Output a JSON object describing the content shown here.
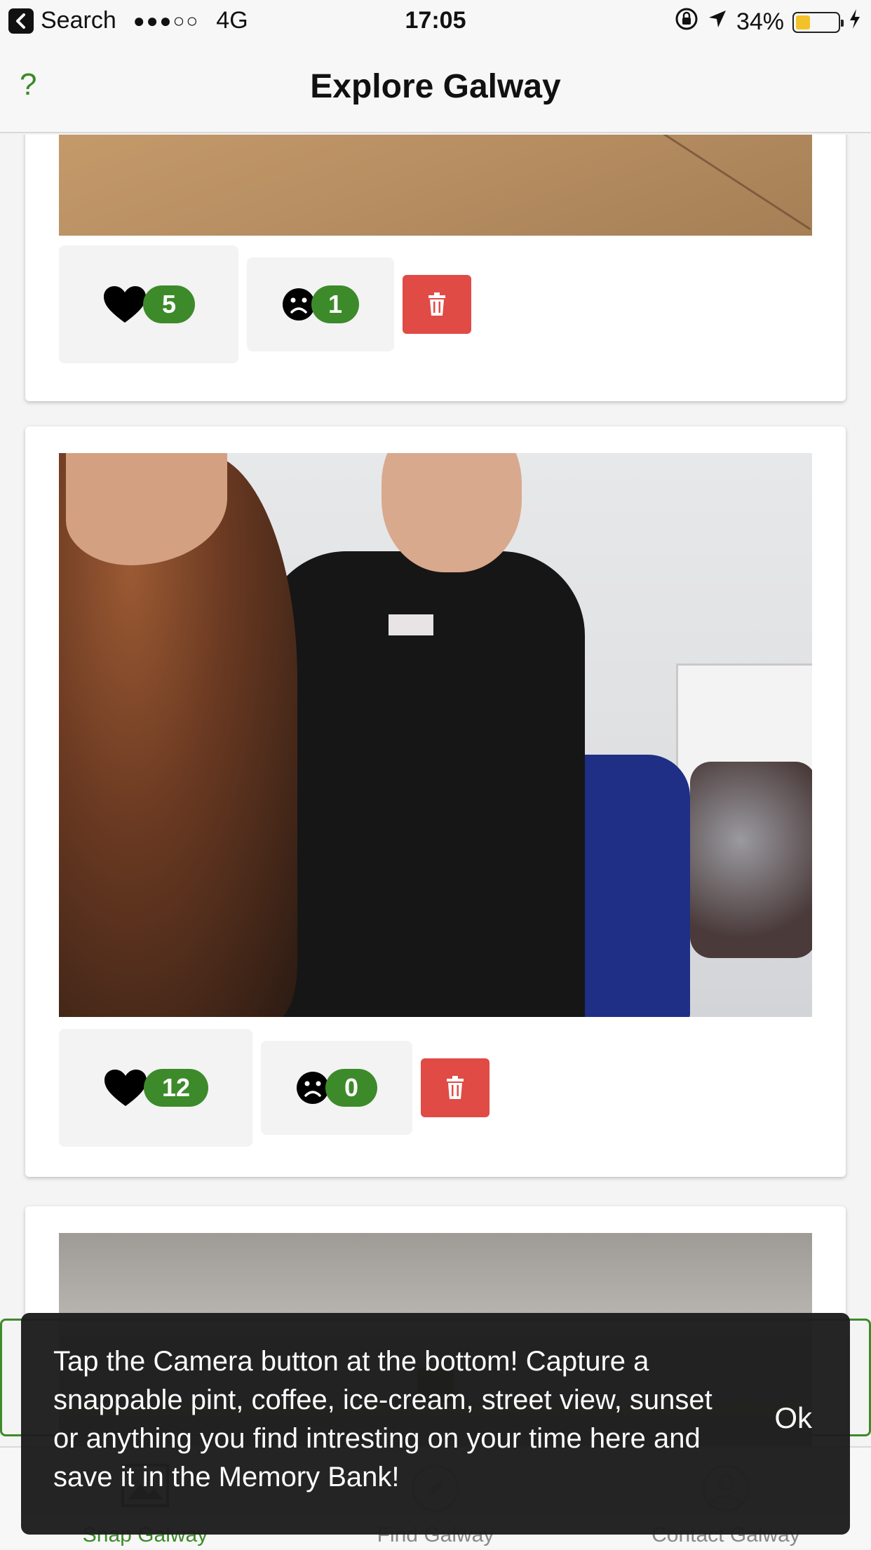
{
  "status_bar": {
    "back_label": "Search",
    "signal": "●●●○○",
    "network": "4G",
    "time": "17:05",
    "battery_pct": "34%",
    "battery_level": 0.34
  },
  "header": {
    "help": "?",
    "title": "Explore Galway"
  },
  "posts": [
    {
      "likes": "5",
      "dislikes": "1"
    },
    {
      "likes": "12",
      "dislikes": "0"
    }
  ],
  "toast": {
    "message": "Tap the Camera button at the bottom! Capture a snappable pint, coffee, ice-cream, street view, sunset or anything you find intresting on your time here and save it in the Memory Bank!",
    "ok": "Ok"
  },
  "tabs": [
    {
      "label": "Snap Galway",
      "icon": "image-icon",
      "active": true
    },
    {
      "label": "Find Galway",
      "icon": "compass-icon",
      "active": false
    },
    {
      "label": "Contact Galway",
      "icon": "person-icon",
      "active": false
    }
  ],
  "colors": {
    "accent": "#3d8a2a",
    "delete": "#e04b45",
    "toast_bg": "#1e1e1e"
  }
}
